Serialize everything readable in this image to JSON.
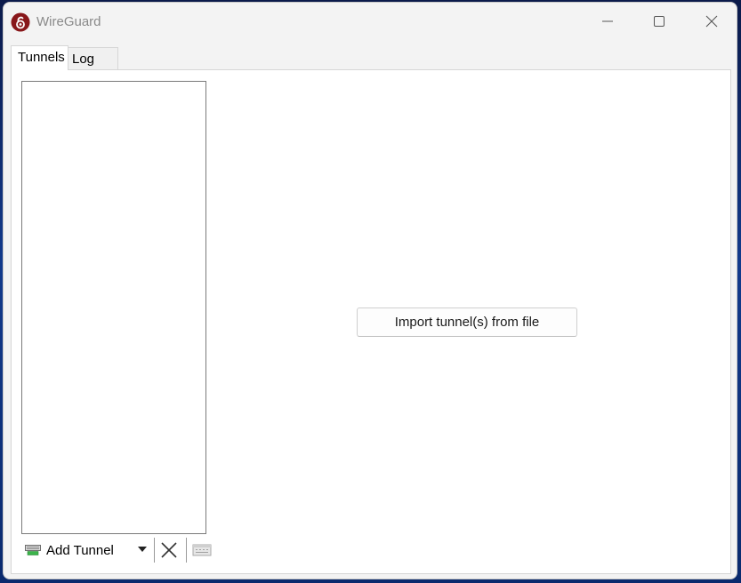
{
  "window": {
    "title": "WireGuard",
    "icon": "wireguard-logo-icon",
    "controls": [
      "minimize-icon",
      "maximize-icon",
      "close-icon"
    ]
  },
  "tabs": [
    {
      "label": "Tunnels",
      "selected": true
    },
    {
      "label": "Log",
      "selected": false
    }
  ],
  "tunnels": {
    "items": [],
    "toolbar": {
      "add_label": "Add Tunnel",
      "add_icon": "add-tunnel-icon",
      "dropdown_icon": "dropdown-arrow-icon",
      "delete_icon": "delete-x-icon",
      "export_icon": "export-zip-icon"
    }
  },
  "main": {
    "import_button_label": "Import tunnel(s) from file"
  },
  "colors": {
    "brand_red": "#88171a",
    "window_bg": "#f3f3f3",
    "panel_bg": "#ffffff"
  }
}
